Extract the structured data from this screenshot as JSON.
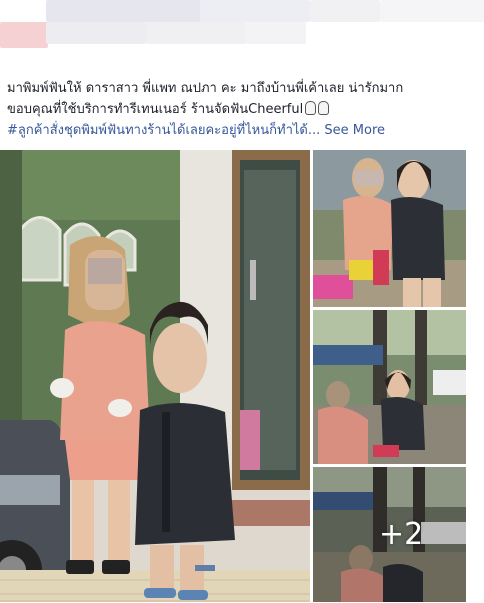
{
  "post": {
    "line1": "มาพิมพ์ฟันให้ ดาราสาว พี่แพท ณปภา คะ มาถึงบ้านพี่เค้าเลย น่ารักมาก",
    "line2": "ขอบคุณที่ใช้บริการทำรีเทนเนอร์ ร้านจัดฟันCheerful",
    "hashtag": "#ลูกค้าสั่งชุดพิมพ์ฟันทางร้านได้เลยคะอยู่ที่ไหนก็ทำได้...",
    "see_more": "See More"
  },
  "photos": {
    "more_count": "+2"
  },
  "colors": {
    "link": "#365899",
    "text": "#1d2129"
  }
}
